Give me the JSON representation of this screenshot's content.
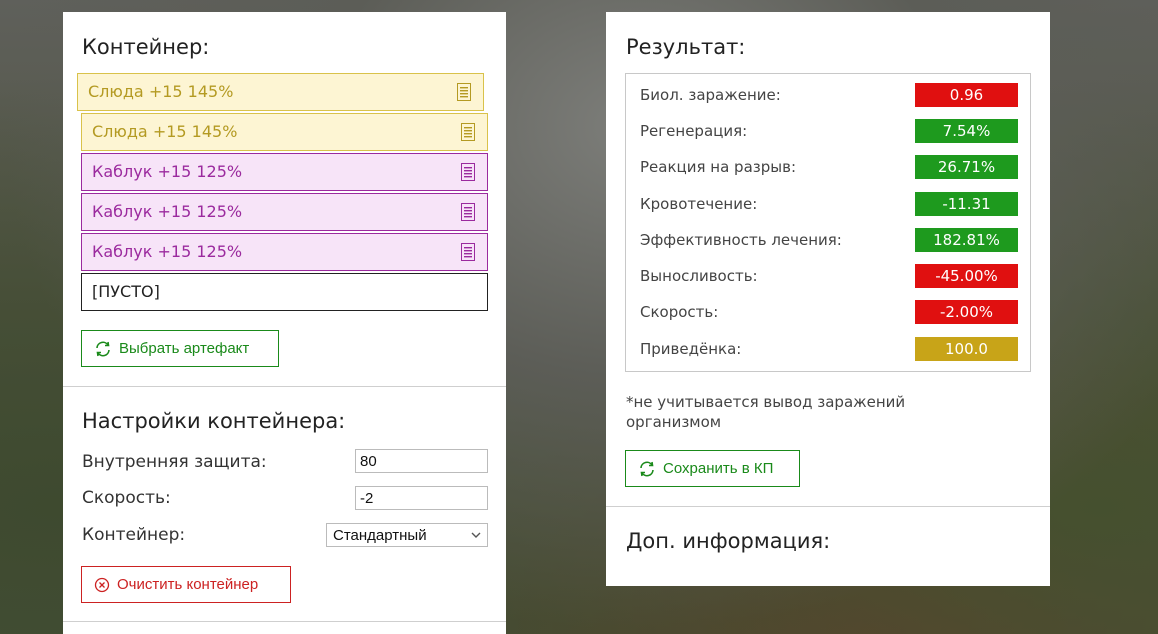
{
  "container": {
    "title": "Контейнер:",
    "slots": [
      {
        "label": "Слюда +15 145%",
        "style": "yellow"
      },
      {
        "label": "Слюда +15 145%",
        "style": "yellow"
      },
      {
        "label": "Каблук +15 125%",
        "style": "purple"
      },
      {
        "label": "Каблук +15 125%",
        "style": "purple"
      },
      {
        "label": "Каблук +15 125%",
        "style": "purple"
      },
      {
        "label": "[ПУСТО]",
        "style": "empty"
      }
    ],
    "select_artifact_label": "Выбрать артефакт"
  },
  "settings": {
    "title": "Настройки контейнера:",
    "internal_protection_label": "Внутренняя защита:",
    "internal_protection_value": "80",
    "speed_label": "Скорость:",
    "speed_value": "-2",
    "container_label": "Контейнер:",
    "container_selected": "Стандартный",
    "clear_label": "Очистить контейнер"
  },
  "result": {
    "title": "Результат:",
    "rows": [
      {
        "label": "Биол. заражение:",
        "value": "0.96",
        "color": "#e01010"
      },
      {
        "label": "Регенерация:",
        "value": "7.54%",
        "color": "#1e9a1e"
      },
      {
        "label": "Реакция на разрыв:",
        "value": "26.71%",
        "color": "#1e9a1e"
      },
      {
        "label": "Кровотечение:",
        "value": "-11.31",
        "color": "#1e9a1e"
      },
      {
        "label": "Эффективность лечения:",
        "value": "182.81%",
        "color": "#1e9a1e"
      },
      {
        "label": "Выносливость:",
        "value": "-45.00%",
        "color": "#e01010"
      },
      {
        "label": "Скорость:",
        "value": "-2.00%",
        "color": "#e01010"
      },
      {
        "label": "Приведёнка:",
        "value": "100.0",
        "color": "#c8a418"
      }
    ],
    "note": "*не учитывается вывод заражений организмом",
    "save_label": "Сохранить в КП"
  },
  "extra": {
    "title": "Доп. информация:"
  },
  "colors": {
    "green": "#1a8a1a",
    "red": "#cc2222",
    "yellow_slot_bg": "#fdf5d3",
    "purple_slot_bg": "#f7e4f8"
  }
}
